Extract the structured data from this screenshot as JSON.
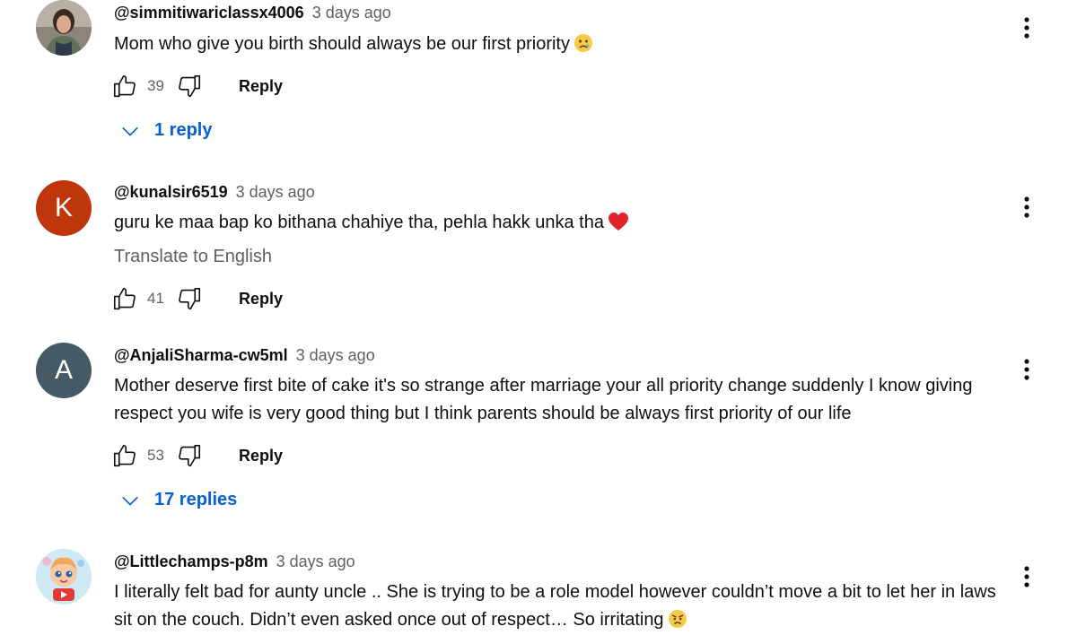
{
  "comments": [
    {
      "author": "@simmitiwariclassx4006",
      "time": "3 days ago",
      "text": "Mom who give you birth should always be our first priority",
      "likes": "39",
      "reply_label": "Reply",
      "replies_label": "1 reply",
      "emoji": "crying-face-icon"
    },
    {
      "author": "@kunalsir6519",
      "time": "3 days ago",
      "text": "guru ke maa bap ko bithana chahiye tha, pehla hakk unka  tha",
      "translate_label": "Translate to English",
      "likes": "41",
      "reply_label": "Reply",
      "avatar_letter": "K",
      "avatar_color": "#bf360c",
      "emoji": "red-heart-icon"
    },
    {
      "author": "@AnjaliSharma-cw5ml",
      "time": "3 days ago",
      "text": "Mother deserve first bite of cake it's so strange after marriage your all priority change suddenly I know giving respect you wife is very good thing but I think parents should be always first priority of our life",
      "likes": "53",
      "reply_label": "Reply",
      "replies_label": "17 replies",
      "avatar_letter": "A",
      "avatar_color": "#455a64"
    },
    {
      "author": "@Littlechamps-p8m",
      "time": "3 days ago",
      "text": "I literally felt bad for aunty uncle .. She is trying to be a role model however couldn’t move a bit to let her in laws sit on the couch. Didn’t even asked once out of respect… So irritating",
      "emoji": "angry-face-icon"
    }
  ],
  "colors": {
    "link_blue": "#065fd4",
    "secondary_text": "#606060"
  }
}
